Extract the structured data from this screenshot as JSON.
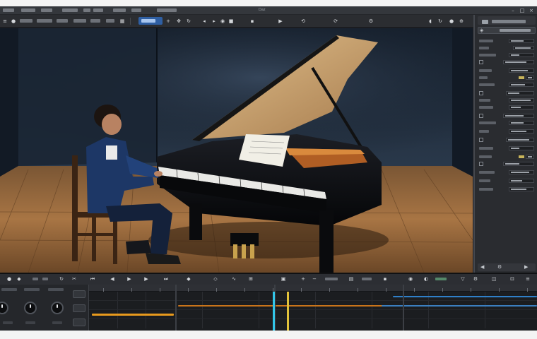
{
  "window": {
    "title": "Daz",
    "controls": [
      "minimize-icon",
      "maximize-icon",
      "close-icon"
    ]
  },
  "menubar": {
    "items": [
      "",
      "",
      "",
      "",
      "",
      "",
      "",
      "",
      ""
    ]
  },
  "toolbar": {
    "groups": [
      "",
      "",
      "",
      ""
    ],
    "active_tool": "",
    "icons": [
      "plus-icon",
      "move-icon",
      "rotate-icon",
      "scale-icon",
      "camera-icon",
      "light-icon",
      "render-icon",
      "grid-icon",
      "play-icon",
      "undo-icon",
      "redo-icon",
      "settings-icon"
    ]
  },
  "viewport": {
    "scene": "boy playing grand piano on wooden stage",
    "colors": {
      "floor": "#9a6b3e",
      "wall": "#1e2c3d",
      "piano": "#0b0c0f",
      "lid_inner": "#caa272"
    }
  },
  "panel": {
    "title": "",
    "subtitle": "",
    "rows": 24
  },
  "timeline": {
    "transport_label": "",
    "tracks": 4,
    "colors": {
      "clip_orange": "#e89a1d",
      "clip_blue": "#2f7fc8",
      "playhead_cyan": "#33c6e8",
      "playhead_yellow": "#e2c23a"
    }
  }
}
